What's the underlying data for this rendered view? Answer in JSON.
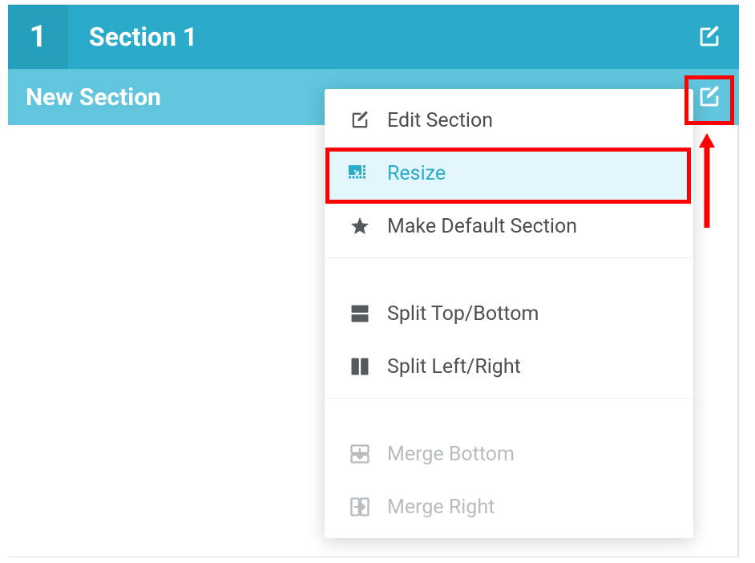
{
  "header": {
    "number": "1",
    "title": "Section 1"
  },
  "subheader": {
    "title": "New Section"
  },
  "menu": {
    "edit_section": "Edit Section",
    "resize": "Resize",
    "make_default": "Make Default Section",
    "split_tb": "Split Top/Bottom",
    "split_lr": "Split Left/Right",
    "merge_bottom": "Merge Bottom",
    "merge_right": "Merge Right"
  }
}
